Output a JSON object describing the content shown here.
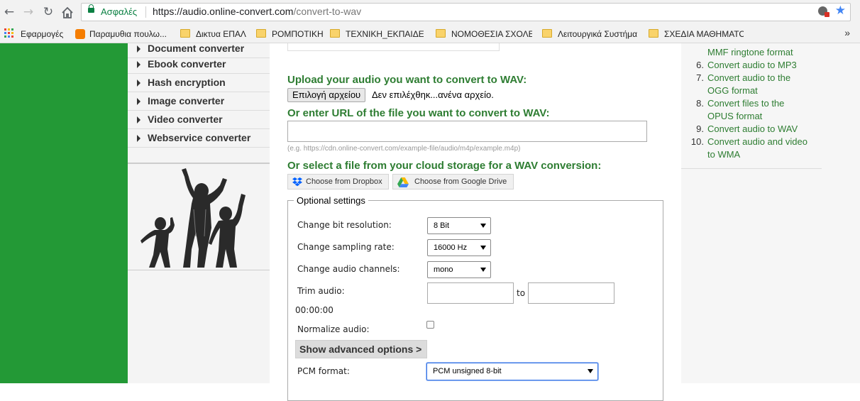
{
  "browser": {
    "secure_label": "Ασφαλές",
    "url_host": "https://audio.online-convert.com",
    "url_path": "/convert-to-wav",
    "bookmarks": [
      {
        "label": "Εφαρμογές",
        "icon": "apps-icon"
      },
      {
        "label": "Παραμυθια πουλω...",
        "icon": "blogger-icon"
      },
      {
        "label": "Δικτυα ΕΠΑΛ",
        "icon": "folder-icon"
      },
      {
        "label": "ΡΟΜΠΟΤΙΚΗ",
        "icon": "folder-icon"
      },
      {
        "label": "ΤΕΧΝΙΚΗ_ΕΚΠΑΙΔΕΥΣ",
        "icon": "folder-icon"
      },
      {
        "label": "ΝΟΜΟΘΕΣΙΑ ΣΧΟΛΕΙ",
        "icon": "folder-icon"
      },
      {
        "label": "Λειτουργικά Συστήμα",
        "icon": "folder-icon"
      },
      {
        "label": "ΣΧΕΔΙΑ ΜΑΘΗΜΑΤΟ",
        "icon": "folder-icon"
      }
    ],
    "more": "»"
  },
  "sidebar": {
    "items": [
      {
        "label": "Document converter"
      },
      {
        "label": "Ebook converter"
      },
      {
        "label": "Hash encryption"
      },
      {
        "label": "Image converter"
      },
      {
        "label": "Video converter"
      },
      {
        "label": "Webservice converter"
      }
    ]
  },
  "main": {
    "upload_heading": "Upload your audio you want to convert to WAV:",
    "file_button": "Επιλογή αρχείου",
    "file_status": "Δεν επιλέχθηκ...ανένα αρχείο.",
    "url_heading": "Or enter URL of the file you want to convert to WAV:",
    "url_hint": "(e.g. https://cdn.online-convert.com/example-file/audio/m4p/example.m4p)",
    "cloud_heading": "Or select a file from your cloud storage for a WAV conversion:",
    "dropbox_label": "Choose from Dropbox",
    "gdrive_label": "Choose from Google Drive",
    "optional_legend": "Optional settings",
    "bit_label": "Change bit resolution:",
    "bit_value": "8 Bit",
    "rate_label": "Change sampling rate:",
    "rate_value": "16000 Hz",
    "channels_label": "Change audio channels:",
    "channels_value": "mono",
    "trim_label": "Trim audio:",
    "trim_to": "to",
    "trim_time": "00:00:00",
    "normalize_label": "Normalize audio:",
    "normalize_checked": false,
    "advanced_button": "Show advanced options >",
    "pcm_label": "PCM format:",
    "pcm_value": "PCM unsigned 8-bit"
  },
  "right_list": {
    "items": [
      {
        "num": "",
        "lines": [
          "MMF ringtone format"
        ]
      },
      {
        "num": "6.",
        "lines": [
          "Convert audio to MP3"
        ]
      },
      {
        "num": "7.",
        "lines": [
          "Convert audio to the",
          "OGG format"
        ]
      },
      {
        "num": "8.",
        "lines": [
          "Convert files to the",
          "OPUS format"
        ]
      },
      {
        "num": "9.",
        "lines": [
          "Convert audio to WAV"
        ]
      },
      {
        "num": "10.",
        "lines": [
          "Convert audio and video",
          "to WMA"
        ]
      }
    ]
  },
  "colors": {
    "brand_green": "#239936",
    "link_green": "#2e7d32",
    "secure_green": "#0b8043"
  }
}
